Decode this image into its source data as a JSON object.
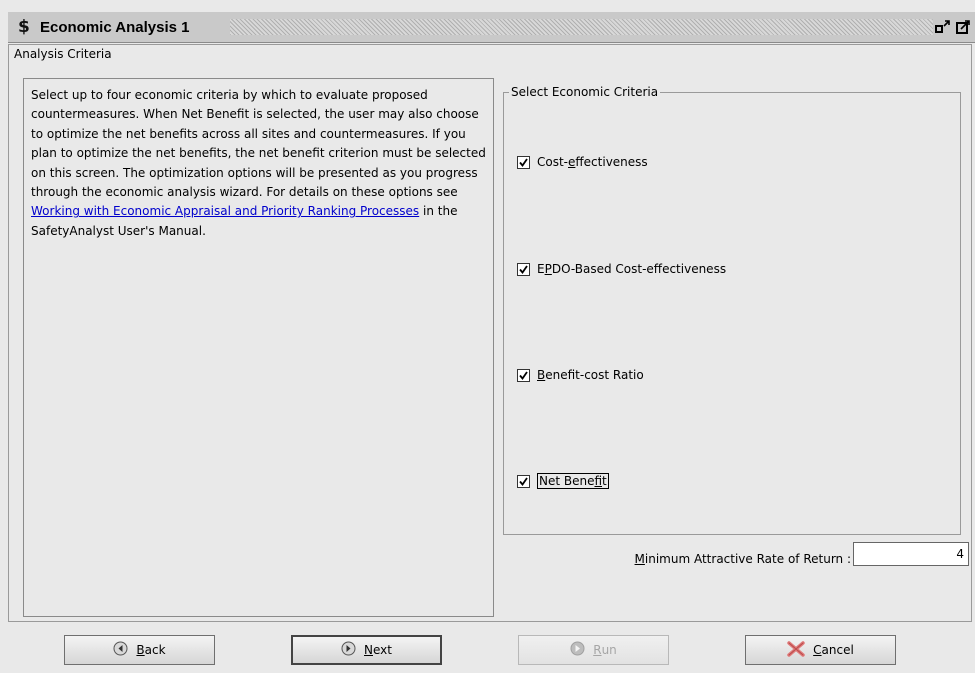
{
  "window": {
    "icon": "dollar-icon",
    "icon_glyph": "$",
    "title": "Economic Analysis 1"
  },
  "group": {
    "label": "Analysis Criteria"
  },
  "info": {
    "text_before_link": "Select up to four economic criteria by which to evaluate proposed countermeasures. When Net Benefit is selected, the user may also choose to optimize the net benefits across all sites and countermeasures. If you plan to optimize the net benefits, the net benefit criterion must be selected on this screen. The optimization options will be presented as you progress through the economic analysis wizard. For details on these options see ",
    "link_text": "Working with Economic Appraisal and Priority Ranking Processes",
    "text_after_link": " in the SafetyAnalyst User's Manual."
  },
  "criteria": {
    "label": "Select Economic Criteria",
    "items": [
      {
        "pre": "Cost-",
        "mn": "e",
        "post": "ffectiveness",
        "checked": true
      },
      {
        "pre": "E",
        "mn": "P",
        "post": "DO-Based Cost-effectiveness",
        "checked": true
      },
      {
        "pre": "",
        "mn": "B",
        "post": "enefit-cost Ratio",
        "checked": true
      },
      {
        "pre": "Net Bene",
        "mn": "f",
        "post": "it",
        "checked": true
      }
    ]
  },
  "rate": {
    "label_mn": "M",
    "label_rest": "inimum Attractive Rate of Return :",
    "value": "4"
  },
  "buttons": {
    "back": {
      "mn": "B",
      "rest": "ack",
      "icon": "back-arrow-icon"
    },
    "next": {
      "mn": "N",
      "rest": "ext",
      "icon": "next-arrow-icon"
    },
    "run": {
      "mn": "R",
      "rest": "un",
      "icon": "run-icon",
      "disabled": true
    },
    "cancel": {
      "mn": "C",
      "rest": "ancel",
      "icon": "cancel-x-icon"
    }
  },
  "colors": {
    "background": "#e9e9e9",
    "titlebar": "#c9c9c9",
    "link": "#0000cc",
    "cancel_x": "#e07a7a"
  }
}
